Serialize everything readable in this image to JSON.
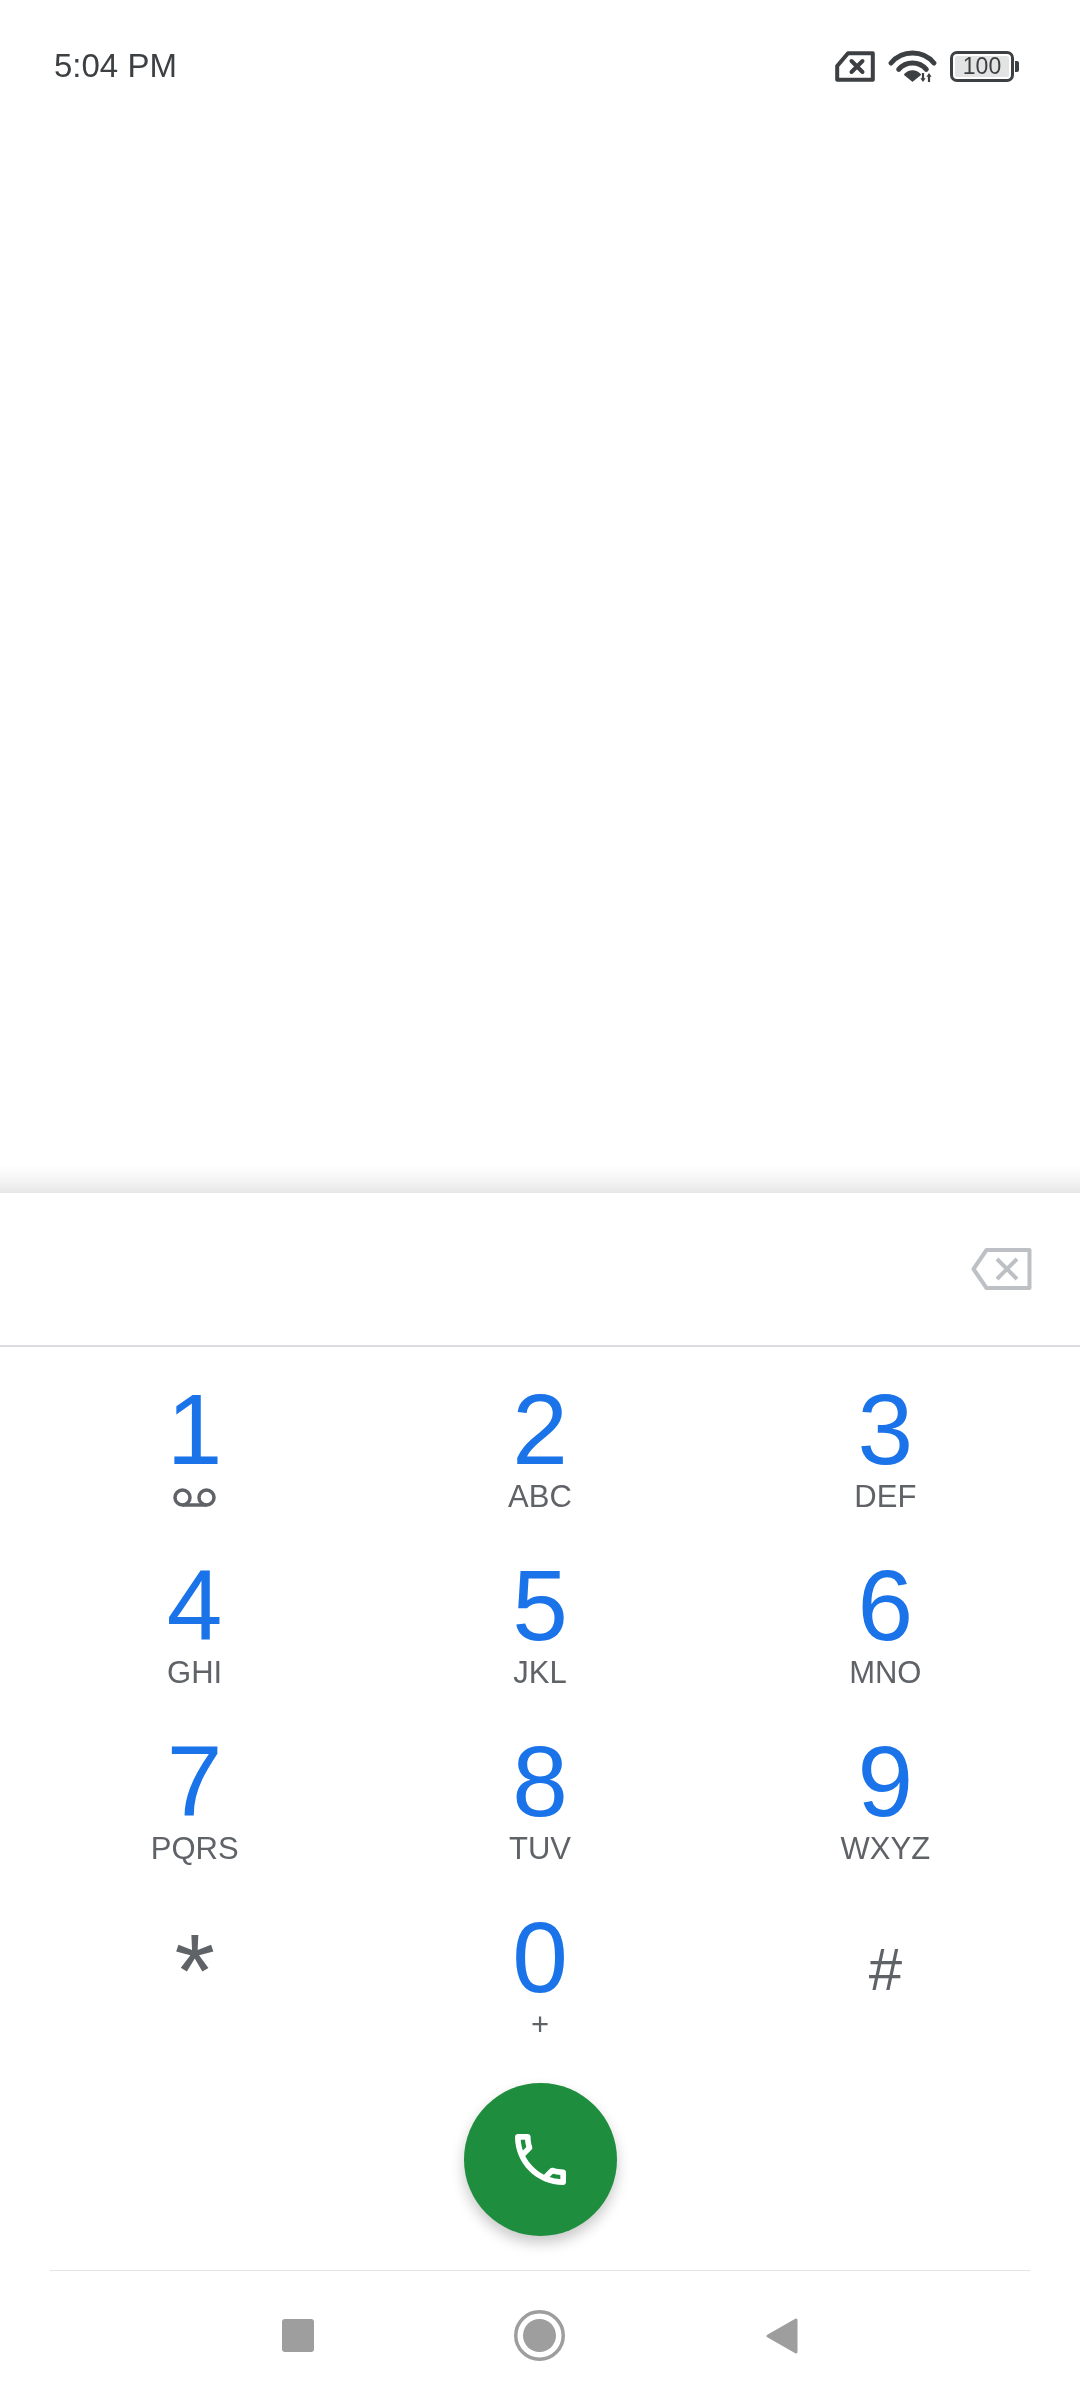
{
  "status_bar": {
    "time": "5:04 PM",
    "battery": "100"
  },
  "keypad": [
    {
      "kind": "voicemail",
      "digit": "1"
    },
    {
      "kind": "letters",
      "digit": "2",
      "letters": "ABC"
    },
    {
      "kind": "letters",
      "digit": "3",
      "letters": "DEF"
    },
    {
      "kind": "letters",
      "digit": "4",
      "letters": "GHI"
    },
    {
      "kind": "letters",
      "digit": "5",
      "letters": "JKL"
    },
    {
      "kind": "letters",
      "digit": "6",
      "letters": "MNO"
    },
    {
      "kind": "letters",
      "digit": "7",
      "letters": "PQRS"
    },
    {
      "kind": "letters",
      "digit": "8",
      "letters": "TUV"
    },
    {
      "kind": "letters",
      "digit": "9",
      "letters": "WXYZ"
    },
    {
      "kind": "symbol",
      "digit": "*"
    },
    {
      "kind": "letters",
      "digit": "0",
      "letters": "+"
    },
    {
      "kind": "symbol",
      "digit": "#"
    }
  ]
}
